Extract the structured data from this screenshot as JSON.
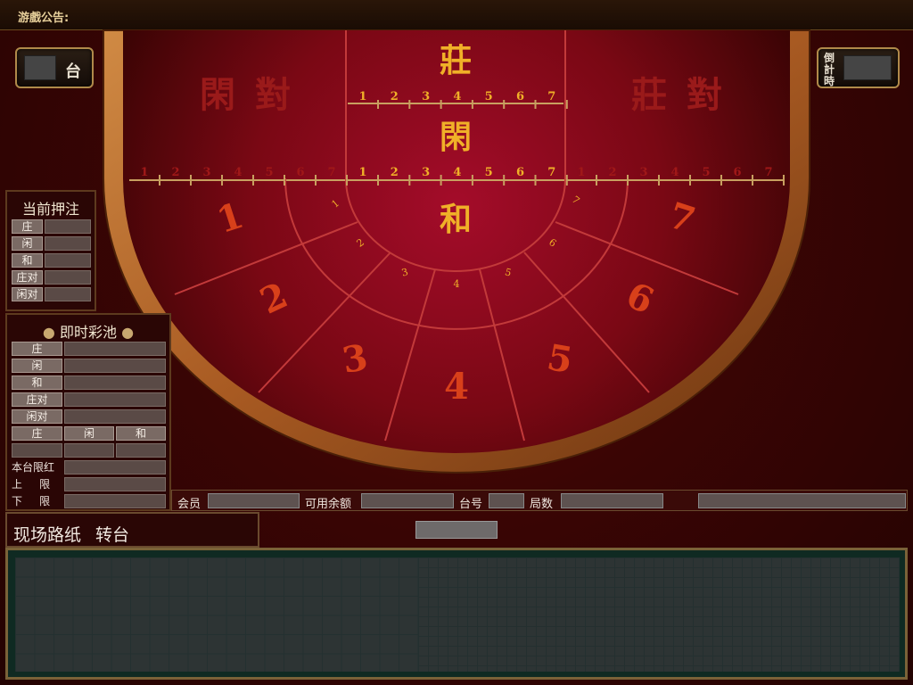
{
  "announcement": {
    "label": "游戲公告:"
  },
  "table_plate": {
    "label": "台"
  },
  "countdown_plate": {
    "label_chars": [
      "倒",
      "計",
      "時"
    ]
  },
  "table_text": {
    "banker": "莊",
    "player": "閑",
    "tie": "和",
    "player_pair_chars": [
      "閑",
      "對"
    ],
    "banker_pair_chars": [
      "莊",
      "對"
    ],
    "scale_numbers": [
      "1",
      "2",
      "3",
      "4",
      "5",
      "6",
      "7"
    ],
    "seat_numbers": [
      "1",
      "2",
      "3",
      "4",
      "5",
      "6",
      "7"
    ]
  },
  "current_bets": {
    "title": "当前押注",
    "rows": [
      "庄",
      "闲",
      "和",
      "庄对",
      "闲对"
    ]
  },
  "jackpot": {
    "title": "即时彩池",
    "rows": [
      "庄",
      "闲",
      "和",
      "庄对",
      "闲对"
    ],
    "sub_cols": [
      "庄",
      "闲",
      "和"
    ],
    "limit_label": "本台限红",
    "upper_label": "上     限",
    "lower_label": "下     限"
  },
  "info_bar": {
    "member": "会员",
    "balance": "可用余额",
    "table_no": "台号",
    "round": "局数"
  },
  "road_header": {
    "road": "现场路纸",
    "switch": "转台"
  },
  "colors": {
    "accent_gold": "#f0b028",
    "felt": "#8a0c14",
    "rim": "#b46a2c"
  }
}
